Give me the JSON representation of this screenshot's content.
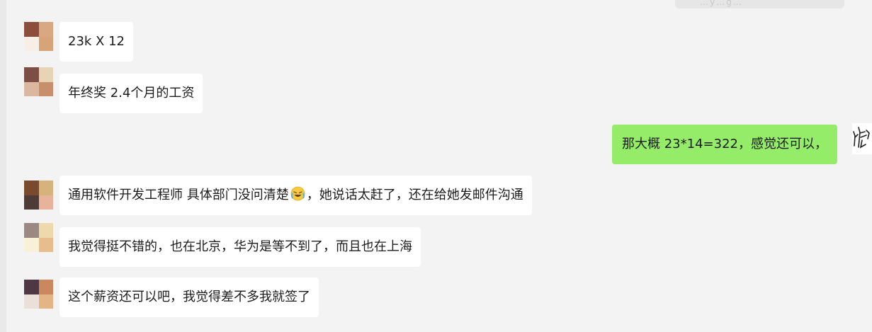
{
  "chat": {
    "top_faded_text": "…y…g…",
    "messages": [
      {
        "side": "left",
        "text": "23k X 12",
        "avatar_colors": [
          "#8b4d3c",
          "#d9a883",
          "#f6eee7",
          "#d7a47a"
        ]
      },
      {
        "side": "left",
        "text": "年终奖 2.4个月的工资",
        "avatar_colors": [
          "#7c4e45",
          "#e6d4b5",
          "#d9b89f",
          "#c88f6c"
        ]
      },
      {
        "side": "right",
        "text": "那大概 23*14=322，感觉还可以，"
      },
      {
        "side": "left",
        "text_before_emoji": "通用软件开发工程师 具体部门没问清楚",
        "emoji": "laughing-crying-emoji",
        "text_after_emoji": "，她说话太赶了，还在给她发邮件沟通",
        "avatar_colors": [
          "#7a4a2f",
          "#d6b37b",
          "#4d3b35",
          "#e8b39b"
        ]
      },
      {
        "side": "left",
        "text": "我觉得挺不错的，也在北京，华为是等不到了，而且也在上海",
        "avatar_colors": [
          "#9a8882",
          "#eed9ad",
          "#f8f1d8",
          "#e6bd8b"
        ]
      },
      {
        "side": "left",
        "text": "这个薪资还可以吧，我觉得差不多我就签了",
        "avatar_colors": [
          "#4d3844",
          "#c9885d",
          "#eae0d9",
          "#e3b584"
        ]
      }
    ],
    "right_avatar_icon": "handwriting-avatar-icon"
  }
}
